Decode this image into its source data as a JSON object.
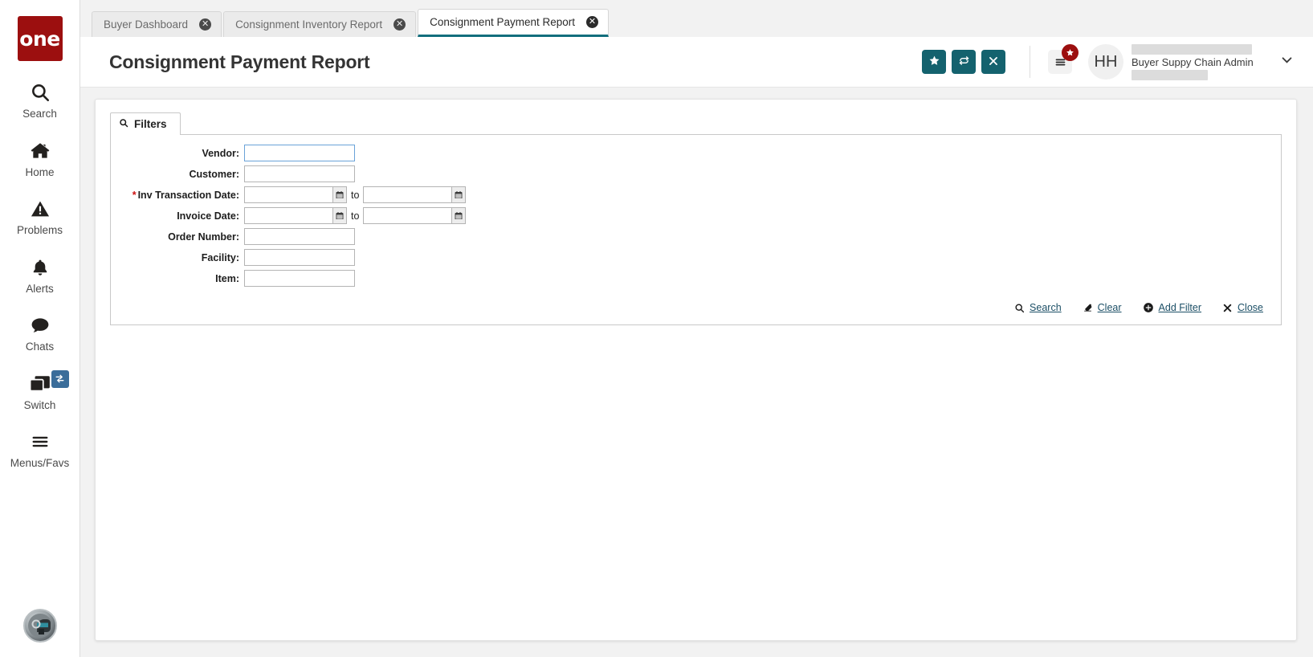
{
  "brand": {
    "logo_text": "one",
    "logo_color": "#9c0f0f"
  },
  "theme": {
    "accent_teal": "#14626e",
    "link_color": "#1c4f66",
    "required_red": "#cc1111",
    "badge_red": "#9c0f0f",
    "switch_badge_blue": "#3a6d9a"
  },
  "sidebar": {
    "items": [
      {
        "label": "Search",
        "icon": "search-icon"
      },
      {
        "label": "Home",
        "icon": "home-icon"
      },
      {
        "label": "Problems",
        "icon": "warning-triangle-icon"
      },
      {
        "label": "Alerts",
        "icon": "bell-icon"
      },
      {
        "label": "Chats",
        "icon": "chat-bubble-icon"
      },
      {
        "label": "Switch",
        "icon": "windows-stack-icon",
        "badge_icon": "swap-arrows-icon"
      },
      {
        "label": "Menus/Favs",
        "icon": "hamburger-icon"
      }
    ],
    "bottom_avatar_icon": "ai-assistant-avatar-icon"
  },
  "tabs": [
    {
      "label": "Buyer Dashboard",
      "active": false,
      "close_icon": "close-circle-icon"
    },
    {
      "label": "Consignment Inventory Report",
      "active": false,
      "close_icon": "close-circle-icon"
    },
    {
      "label": "Consignment Payment Report",
      "active": true,
      "close_icon": "close-circle-icon"
    }
  ],
  "header": {
    "title": "Consignment Payment Report",
    "actions": [
      {
        "name": "favorite-button",
        "icon": "star-icon"
      },
      {
        "name": "refresh-button",
        "icon": "refresh-icon"
      },
      {
        "name": "close-button",
        "icon": "x-icon"
      }
    ],
    "menu": {
      "icon": "hamburger-icon",
      "badge_icon": "star-icon"
    },
    "user": {
      "initials": "HH",
      "role": "Buyer Suppy Chain Admin",
      "name_redacted": true
    },
    "caret_icon": "chevron-down-icon"
  },
  "filters": {
    "tab_label": "Filters",
    "tab_icon": "search-icon",
    "fields": [
      {
        "label": "Vendor:",
        "value": "",
        "required": false,
        "type": "text",
        "focused": true
      },
      {
        "label": "Customer:",
        "value": "",
        "required": false,
        "type": "text",
        "focused": false
      },
      {
        "label": "Inv Transaction Date:",
        "value": "",
        "value_to": "",
        "required": true,
        "type": "daterange",
        "to_label": "to"
      },
      {
        "label": "Invoice Date:",
        "value": "",
        "value_to": "",
        "required": false,
        "type": "daterange",
        "to_label": "to"
      },
      {
        "label": "Order Number:",
        "value": "",
        "required": false,
        "type": "text",
        "focused": false
      },
      {
        "label": "Facility:",
        "value": "",
        "required": false,
        "type": "text",
        "focused": false
      },
      {
        "label": "Item:",
        "value": "",
        "required": false,
        "type": "text",
        "focused": false
      }
    ],
    "links": [
      {
        "label": "Search",
        "icon": "search-icon"
      },
      {
        "label": "Clear",
        "icon": "eraser-icon"
      },
      {
        "label": "Add Filter",
        "icon": "plus-circle-icon"
      },
      {
        "label": "Close",
        "icon": "x-icon"
      }
    ]
  }
}
